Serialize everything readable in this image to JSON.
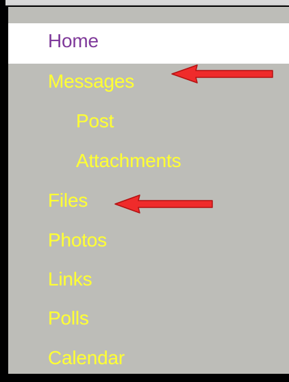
{
  "navigation": {
    "items": [
      {
        "label": "Home"
      },
      {
        "label": "Messages"
      },
      {
        "label": "Post"
      },
      {
        "label": "Attachments"
      },
      {
        "label": "Files"
      },
      {
        "label": "Photos"
      },
      {
        "label": "Links"
      },
      {
        "label": "Polls"
      },
      {
        "label": "Calendar"
      }
    ]
  },
  "annotations": {
    "arrows": [
      {
        "icon": "red-arrow-left-icon",
        "target": "Messages"
      },
      {
        "icon": "red-arrow-left-icon",
        "target": "Files"
      }
    ]
  },
  "colors": {
    "link_text": "#ffff33",
    "selected_link_text": "#7f3a9e",
    "panel_background": "#bdbdb8",
    "selected_background": "#ffffff",
    "annotation_red": "#ef2b2b"
  }
}
